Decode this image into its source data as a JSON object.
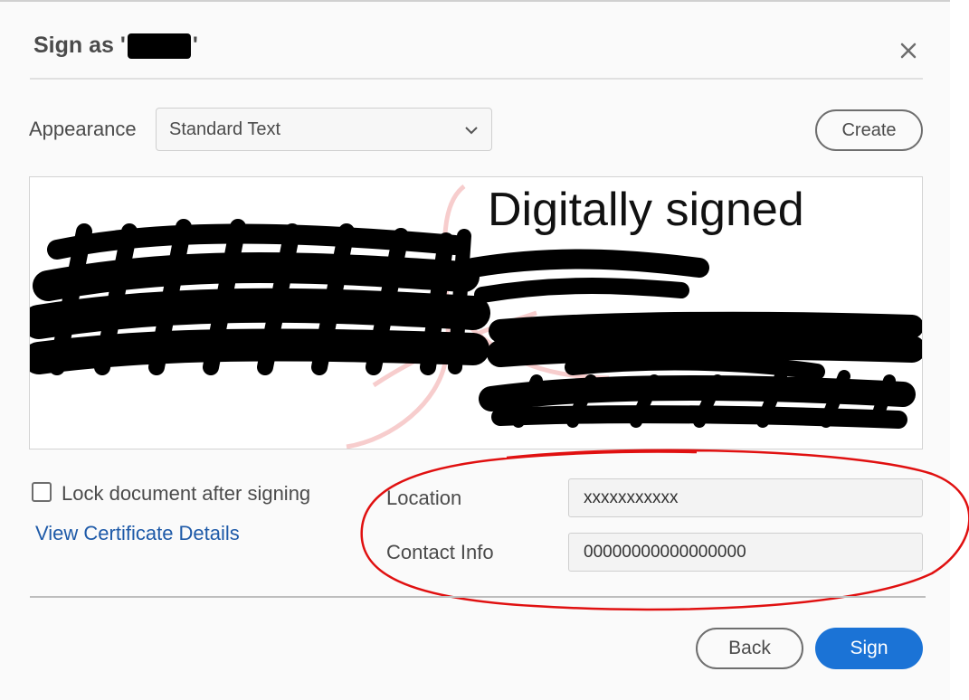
{
  "dialog": {
    "title_prefix": "Sign as '",
    "title_suffix": "'",
    "close_icon": "close-icon"
  },
  "appearance": {
    "label": "Appearance",
    "selected": "Standard Text",
    "create_label": "Create"
  },
  "preview": {
    "heading": "Digitally signed"
  },
  "options": {
    "lock_label": "Lock document after signing",
    "lock_checked": false,
    "certificate_link": "View Certificate Details"
  },
  "fields": {
    "location_label": "Location",
    "location_value": "xxxxxxxxxxx",
    "contact_label": "Contact Info",
    "contact_value": "00000000000000000"
  },
  "footer": {
    "back_label": "Back",
    "sign_label": "Sign"
  },
  "colors": {
    "primary": "#1b73d6",
    "link": "#1e5aa8",
    "annotation": "#e01010"
  }
}
